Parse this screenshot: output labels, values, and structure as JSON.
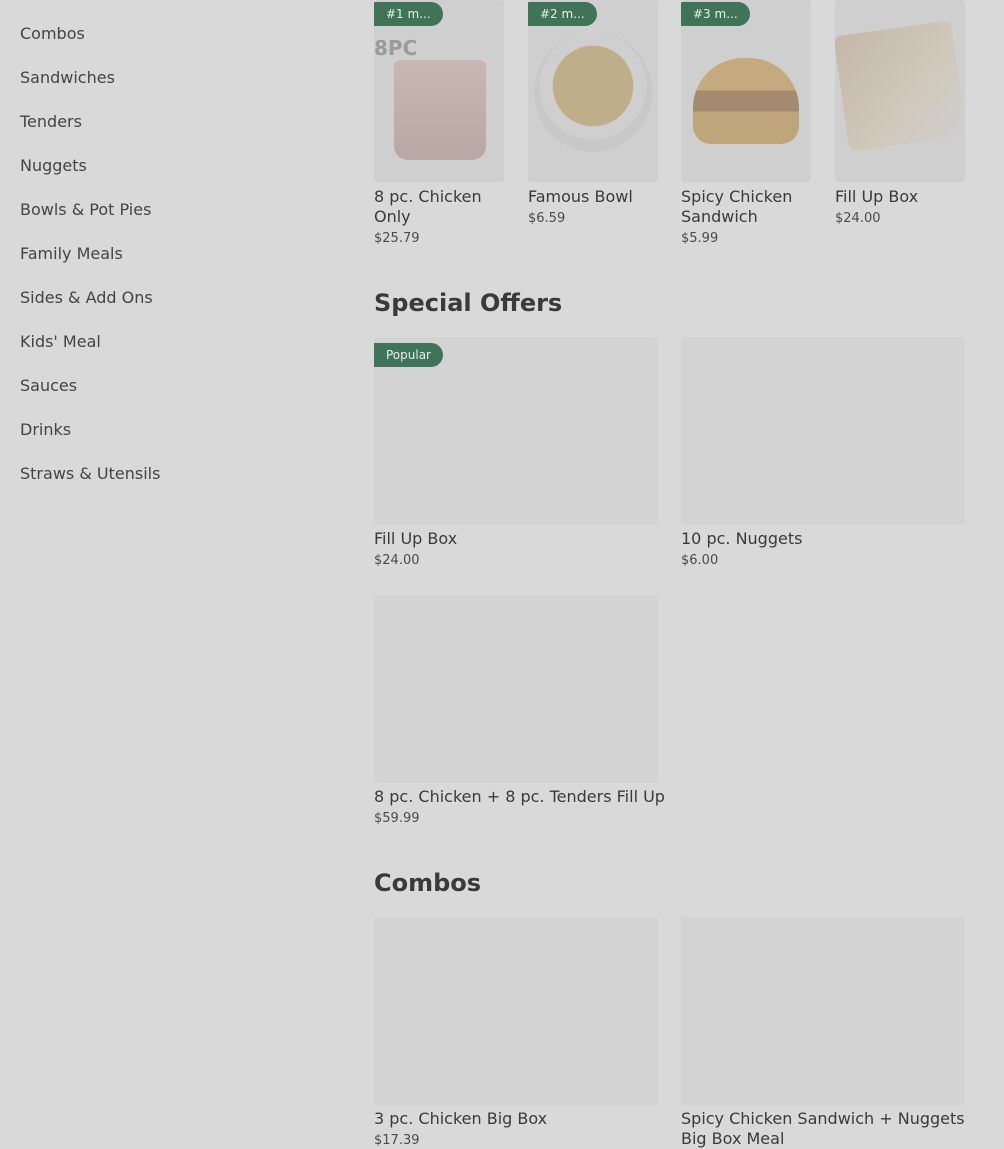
{
  "sidebar": {
    "items": [
      {
        "label": "Combos"
      },
      {
        "label": "Sandwiches"
      },
      {
        "label": "Tenders"
      },
      {
        "label": "Nuggets"
      },
      {
        "label": "Bowls & Pot Pies"
      },
      {
        "label": "Family Meals"
      },
      {
        "label": "Sides & Add Ons"
      },
      {
        "label": "Kids' Meal"
      },
      {
        "label": "Sauces"
      },
      {
        "label": "Drinks"
      },
      {
        "label": "Straws & Utensils"
      }
    ]
  },
  "top_items": [
    {
      "badge": "#1 m...",
      "name_line1": "8 pc. Chicken",
      "name_line2": "Only",
      "price": "$25.79",
      "image_text": "8PC"
    },
    {
      "badge": "#2 m...",
      "name_line1": "Famous Bowl",
      "name_line2": "",
      "price": "$6.59"
    },
    {
      "badge": "#3 m...",
      "name_line1": "Spicy Chicken",
      "name_line2": "Sandwich",
      "price": "$5.99"
    },
    {
      "badge": "",
      "name_line1": "Fill Up Box",
      "name_line2": "",
      "price": "$24.00"
    }
  ],
  "special_offers": {
    "title": "Special Offers",
    "items": [
      {
        "badge": "Popular",
        "name": "Fill Up Box",
        "price": "$24.00"
      },
      {
        "badge": "",
        "name": "10 pc. Nuggets",
        "price": "$6.00"
      },
      {
        "badge": "",
        "name": "8 pc. Chicken + 8 pc. Tenders Fill Up",
        "price": "$59.99"
      }
    ]
  },
  "combos": {
    "title": "Combos",
    "items": [
      {
        "name_line1": "3 pc. Chicken Big Box",
        "name_line2": "",
        "price": "$17.39"
      },
      {
        "name_line1": "Spicy Chicken Sandwich + Nuggets",
        "name_line2": "Big Box Meal",
        "price": ""
      }
    ]
  }
}
